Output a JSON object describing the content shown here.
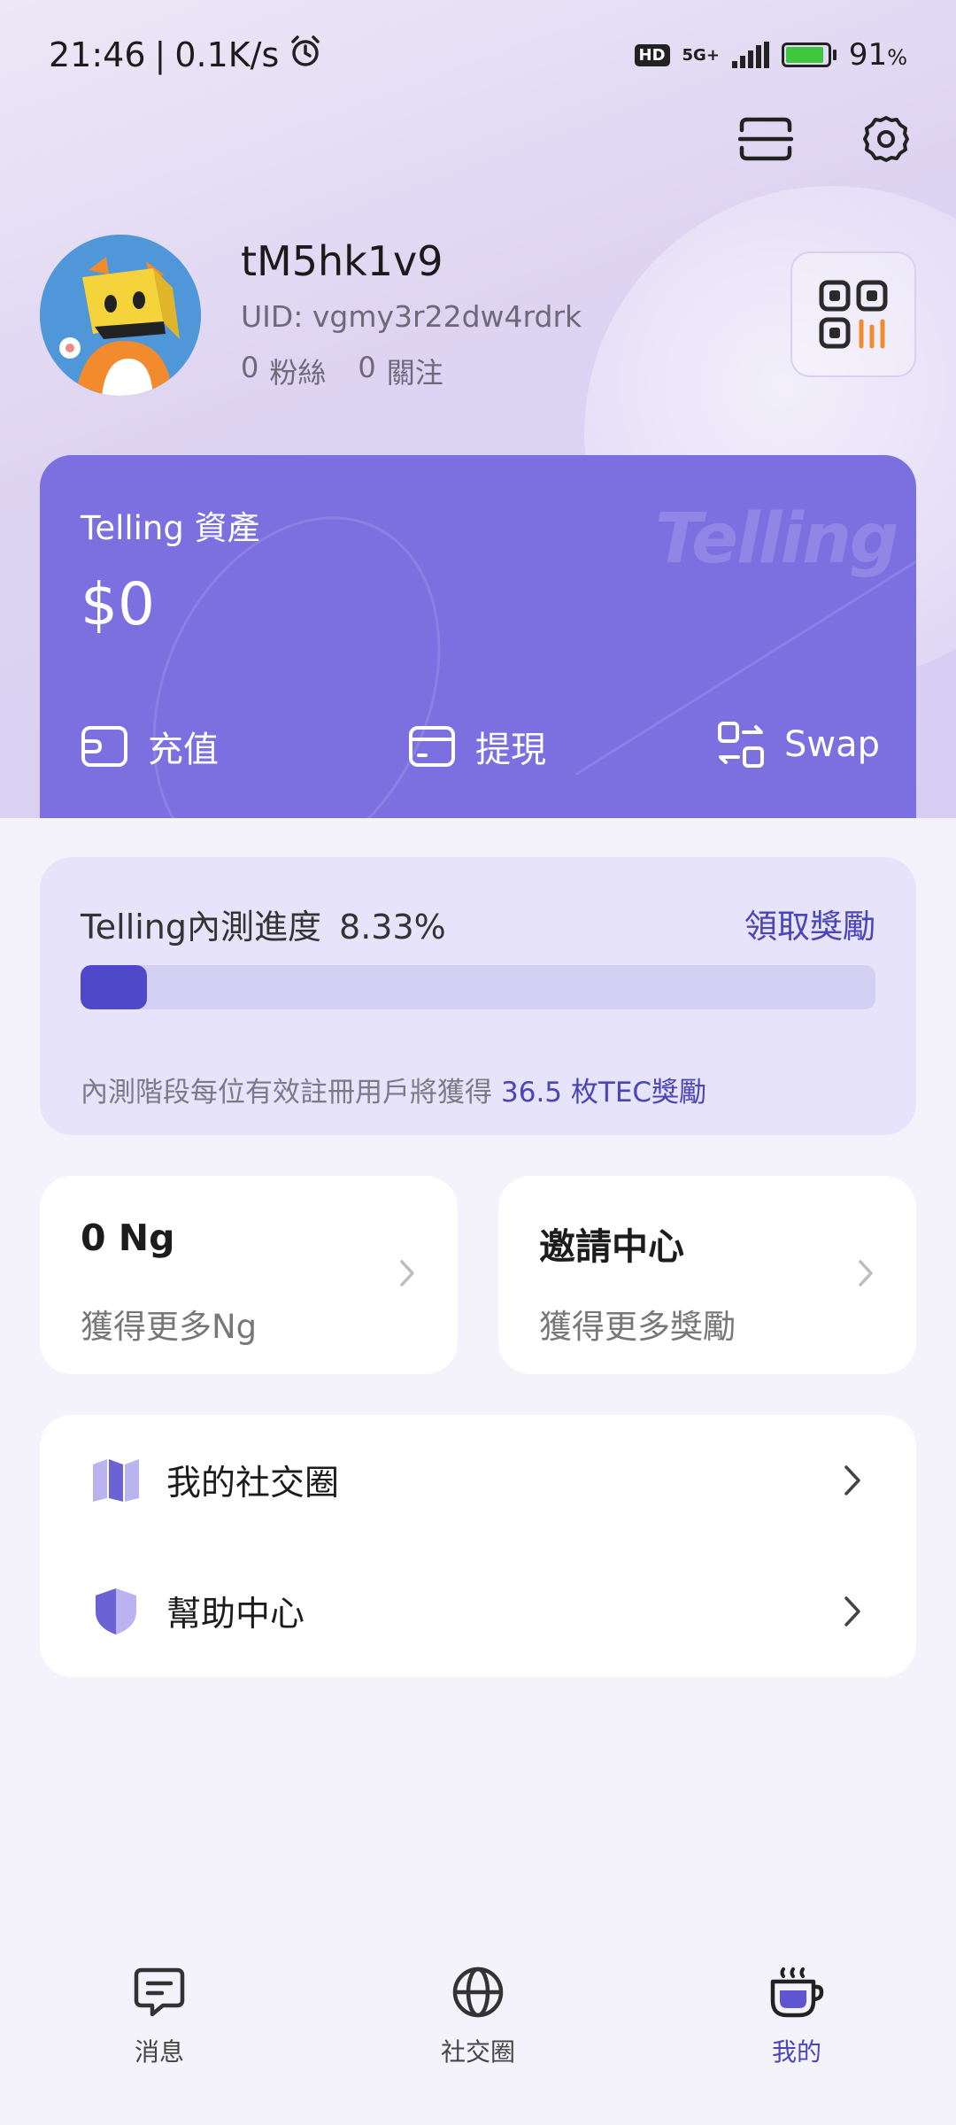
{
  "status_bar": {
    "time": "21:46",
    "net_speed": "0.1K/s",
    "hd": "HD",
    "network": "5G+",
    "battery_value": "91",
    "battery_unit": "%",
    "battery_level": 0.91
  },
  "profile": {
    "username": "tM5hk1v9",
    "uid": "UID: vgmy3r22dw4rdrk",
    "followers_count": "0",
    "followers_label": "粉絲",
    "following_count": "0",
    "following_label": "關注"
  },
  "asset_card": {
    "title": "Telling 資產",
    "value": "$0",
    "watermark": "Telling",
    "actions": {
      "recharge": "充值",
      "withdraw": "提現",
      "swap": "Swap"
    }
  },
  "beta_progress": {
    "label": "Telling內測進度",
    "percent_text": "8.33%",
    "progress": 0.0833,
    "claim_link": "領取獎勵",
    "note": "內測階段每位有效註冊用戶將獲得",
    "reward": "36.5 枚TEC獎勵"
  },
  "cards": {
    "ng": {
      "title": "0 Ng",
      "subtitle": "獲得更多Ng"
    },
    "invite": {
      "title": "邀請中心",
      "subtitle": "獲得更多獎勵"
    }
  },
  "menu": {
    "social_circle": "我的社交圈",
    "help_center": "幫助中心"
  },
  "bottom_nav": {
    "messages": "消息",
    "social": "社交圈",
    "me": "我的",
    "active": "me"
  },
  "colors": {
    "accent": "#4a45b8",
    "card_purple": "#7c6fe0",
    "progress_bg": "#e6e3fa"
  }
}
